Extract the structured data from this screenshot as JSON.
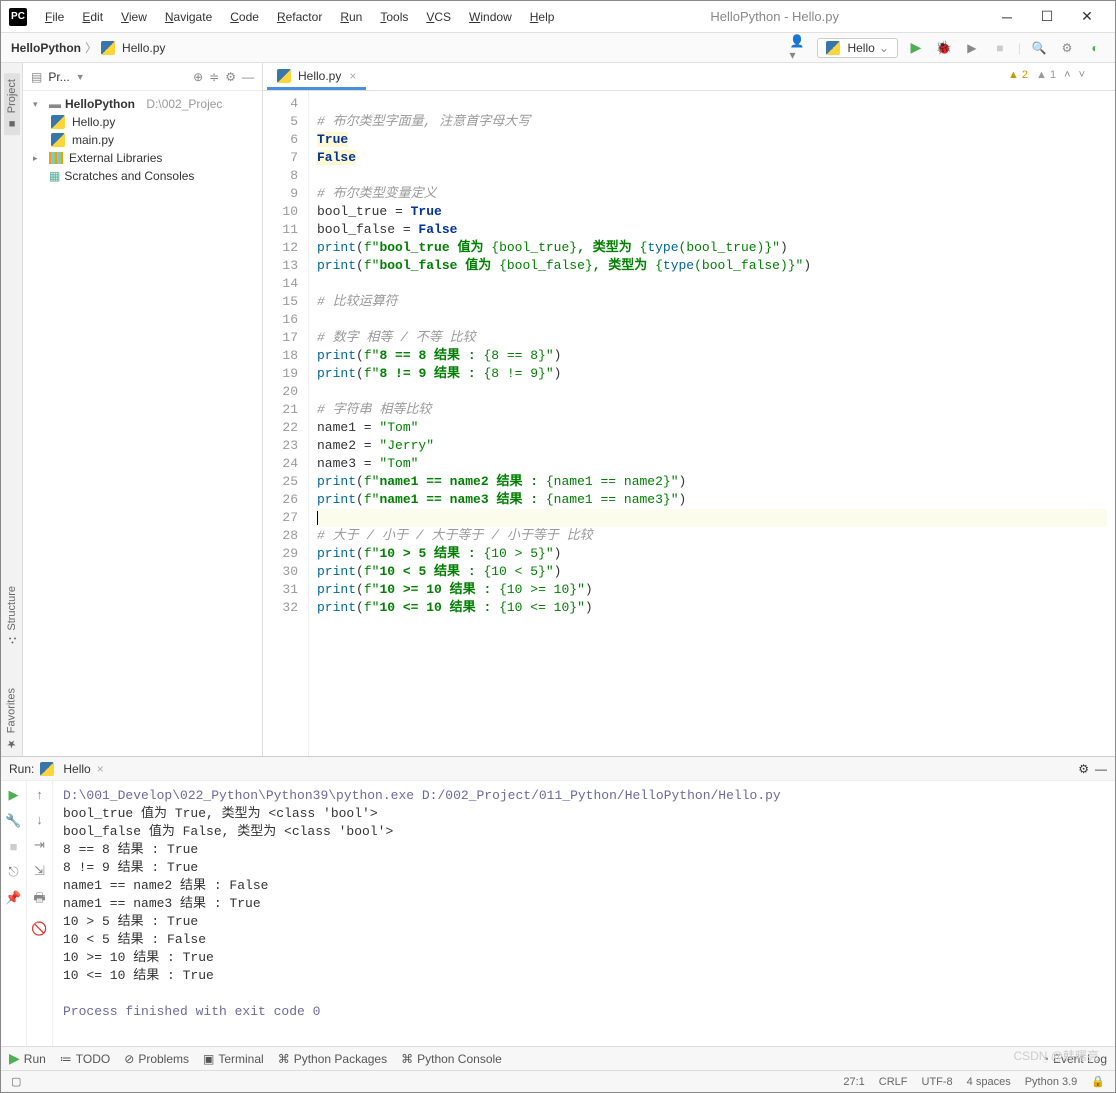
{
  "window_title": "HelloPython - Hello.py",
  "menu": [
    "File",
    "Edit",
    "View",
    "Navigate",
    "Code",
    "Refactor",
    "Run",
    "Tools",
    "VCS",
    "Window",
    "Help"
  ],
  "breadcrumb": {
    "project": "HelloPython",
    "file": "Hello.py"
  },
  "run_config_name": "Hello",
  "project_panel": {
    "title": "Pr...",
    "root": "HelloPython",
    "root_path": "D:\\002_Projec",
    "files": [
      "Hello.py",
      "main.py"
    ],
    "external": "External Libraries",
    "scratches": "Scratches and Consoles"
  },
  "tab_name": "Hello.py",
  "editor_badges": {
    "warn": "2",
    "info": "1"
  },
  "gutter_labels": {
    "project": "Project",
    "structure": "Structure",
    "favorites": "Favorites"
  },
  "code_lines": [
    {
      "n": 4,
      "html": ""
    },
    {
      "n": 5,
      "html": "<span class='c-comment'># 布尔类型字面量, 注意首字母大写</span>"
    },
    {
      "n": 6,
      "html": "<span class='gold-bg c-kw'>True</span>"
    },
    {
      "n": 7,
      "html": "<span class='gold-bg c-kw'>False</span>"
    },
    {
      "n": 8,
      "html": ""
    },
    {
      "n": 9,
      "html": "<span class='c-comment'># 布尔类型变量定义</span>"
    },
    {
      "n": 10,
      "html": "bool_true = <span class='c-kw'>True</span>"
    },
    {
      "n": 11,
      "html": "bool_false = <span class='c-kw'>False</span>"
    },
    {
      "n": 12,
      "html": "<span class='c-builtin'>print</span>(<span class='c-str'>f\"</span><span class='c-strbold'>bool_true 值为 </span><span class='c-str'>{bool_true}</span><span class='c-strbold'>, 类型为 </span><span class='c-str'>{</span><span class='c-builtin'>type</span><span class='c-str'>(bool_true)}\"</span>)"
    },
    {
      "n": 13,
      "html": "<span class='c-builtin'>print</span>(<span class='c-str'>f\"</span><span class='c-strbold'>bool_false 值为 </span><span class='c-str'>{bool_false}</span><span class='c-strbold'>, 类型为 </span><span class='c-str'>{</span><span class='c-builtin'>type</span><span class='c-str'>(bool_false)}\"</span>)"
    },
    {
      "n": 14,
      "html": ""
    },
    {
      "n": 15,
      "html": "<span class='c-comment'># 比较运算符</span>"
    },
    {
      "n": 16,
      "html": ""
    },
    {
      "n": 17,
      "html": "<span class='c-comment'># 数字 相等 / 不等 比较</span>"
    },
    {
      "n": 18,
      "html": "<span class='c-builtin'>print</span>(<span class='c-str'>f\"</span><span class='c-strbold'>8 == 8 结果 : </span><span class='c-str'>{8 == 8}\"</span>)"
    },
    {
      "n": 19,
      "html": "<span class='c-builtin'>print</span>(<span class='c-str'>f\"</span><span class='c-strbold'>8 != 9 结果 : </span><span class='c-str'>{8 != 9}\"</span>)"
    },
    {
      "n": 20,
      "html": ""
    },
    {
      "n": 21,
      "html": "<span class='c-comment'># 字符串 相等比较</span>"
    },
    {
      "n": 22,
      "html": "name1 = <span class='c-str'>\"Tom\"</span>"
    },
    {
      "n": 23,
      "html": "name2 = <span class='c-str'>\"Jerry\"</span>"
    },
    {
      "n": 24,
      "html": "name3 = <span class='c-str'>\"Tom\"</span>"
    },
    {
      "n": 25,
      "html": "<span class='c-builtin'>print</span>(<span class='c-str'>f\"</span><span class='c-strbold'>name1 == name2 结果 : </span><span class='c-str'>{name1 == name2}\"</span>)"
    },
    {
      "n": 26,
      "html": "<span class='c-builtin'>print</span>(<span class='c-str'>f\"</span><span class='c-strbold'>name1 == name3 结果 : </span><span class='c-str'>{name1 == name3}\"</span>)"
    },
    {
      "n": 27,
      "html": "<span class='cursor-caret'></span>",
      "hl": true
    },
    {
      "n": 28,
      "html": "<span class='c-comment'># 大于 / 小于 / 大于等于 / 小于等于 比较</span>"
    },
    {
      "n": 29,
      "html": "<span class='c-builtin'>print</span>(<span class='c-str'>f\"</span><span class='c-strbold'>10 &gt; 5 结果 : </span><span class='c-str'>{10 &gt; 5}\"</span>)"
    },
    {
      "n": 30,
      "html": "<span class='c-builtin'>print</span>(<span class='c-str'>f\"</span><span class='c-strbold'>10 &lt; 5 结果 : </span><span class='c-str'>{10 &lt; 5}\"</span>)"
    },
    {
      "n": 31,
      "html": "<span class='c-builtin'>print</span>(<span class='c-str'>f\"</span><span class='c-strbold'>10 &gt;= 10 结果 : </span><span class='c-str'>{10 &gt;= 10}\"</span>)"
    },
    {
      "n": 32,
      "html": "<span class='c-builtin'>print</span>(<span class='c-str'>f\"</span><span class='c-strbold'>10 &lt;= 10 结果 : </span><span class='c-str'>{10 &lt;= 10}\"</span>)"
    }
  ],
  "run_panel": {
    "label": "Run:",
    "tab": "Hello",
    "lines": [
      {
        "cls": "path",
        "text": "D:\\001_Develop\\022_Python\\Python39\\python.exe D:/002_Project/011_Python/HelloPython/Hello.py"
      },
      {
        "cls": "",
        "text": "bool_true 值为 True, 类型为 <class 'bool'>"
      },
      {
        "cls": "",
        "text": "bool_false 值为 False, 类型为 <class 'bool'>"
      },
      {
        "cls": "",
        "text": "8 == 8 结果 : True"
      },
      {
        "cls": "",
        "text": "8 != 9 结果 : True"
      },
      {
        "cls": "",
        "text": "name1 == name2 结果 : False"
      },
      {
        "cls": "",
        "text": "name1 == name3 结果 : True"
      },
      {
        "cls": "",
        "text": "10 > 5 结果 : True"
      },
      {
        "cls": "",
        "text": "10 < 5 结果 : False"
      },
      {
        "cls": "",
        "text": "10 >= 10 结果 : True"
      },
      {
        "cls": "",
        "text": "10 <= 10 结果 : True"
      },
      {
        "cls": "",
        "text": ""
      },
      {
        "cls": "path",
        "text": "Process finished with exit code 0"
      }
    ]
  },
  "bottom_bar": {
    "run": "Run",
    "todo": "TODO",
    "problems": "Problems",
    "terminal": "Terminal",
    "pkgs": "Python Packages",
    "pyconsole": "Python Console",
    "eventlog": "Event Log"
  },
  "status": {
    "pos": "27:1",
    "crlf": "CRLF",
    "enc": "UTF-8",
    "indent": "4 spaces",
    "py": "Python 3.9"
  },
  "watermark": "CSDN @韩曙亮"
}
